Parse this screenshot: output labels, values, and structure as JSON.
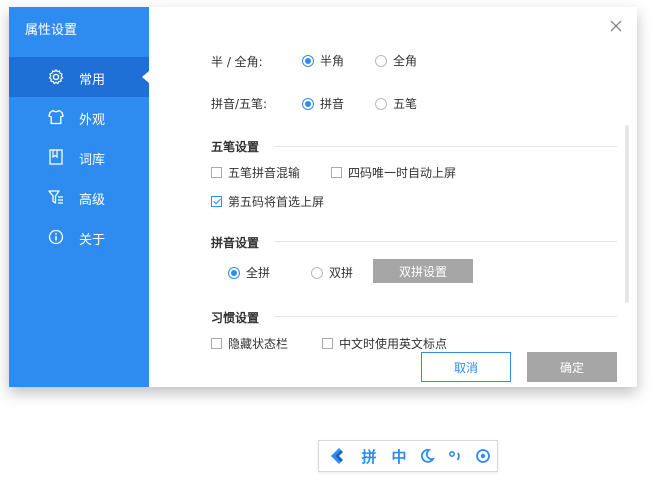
{
  "dialog": {
    "title": "属性设置"
  },
  "sidebar": {
    "items": [
      {
        "label": "常用",
        "icon": "gear-icon"
      },
      {
        "label": "外观",
        "icon": "shirt-icon"
      },
      {
        "label": "词库",
        "icon": "book-icon"
      },
      {
        "label": "高级",
        "icon": "filter-icon"
      },
      {
        "label": "关于",
        "icon": "info-icon"
      }
    ],
    "active": "常用"
  },
  "width_mode": {
    "label": "半 / 全角:",
    "options": [
      "半角",
      "全角"
    ],
    "selected": "半角"
  },
  "input_mode": {
    "label": "拼音/五笔:",
    "options": [
      "拼音",
      "五笔"
    ],
    "selected": "拼音"
  },
  "wubi_settings": {
    "title": "五笔设置",
    "options": [
      {
        "label": "五笔拼音混输",
        "checked": false
      },
      {
        "label": "四码唯一时自动上屏",
        "checked": false
      },
      {
        "label": "第五码将首选上屏",
        "checked": true
      }
    ]
  },
  "pinyin_settings": {
    "title": "拼音设置",
    "options": [
      "全拼",
      "双拼"
    ],
    "selected": "全拼",
    "shuangpin_button": "双拼设置"
  },
  "habit_settings": {
    "title": "习惯设置",
    "options": [
      {
        "label": "隐藏状态栏",
        "checked": false
      },
      {
        "label": "中文时使用英文标点",
        "checked": false
      }
    ]
  },
  "footer": {
    "cancel": "取消",
    "confirm": "确定"
  },
  "toolbar": {
    "pinyin": "拼",
    "chinese": "中"
  },
  "colors": {
    "accent": "#2e8cf0",
    "sidebar_active": "#1e6fd6",
    "disabled_button": "#a6a6a6"
  }
}
